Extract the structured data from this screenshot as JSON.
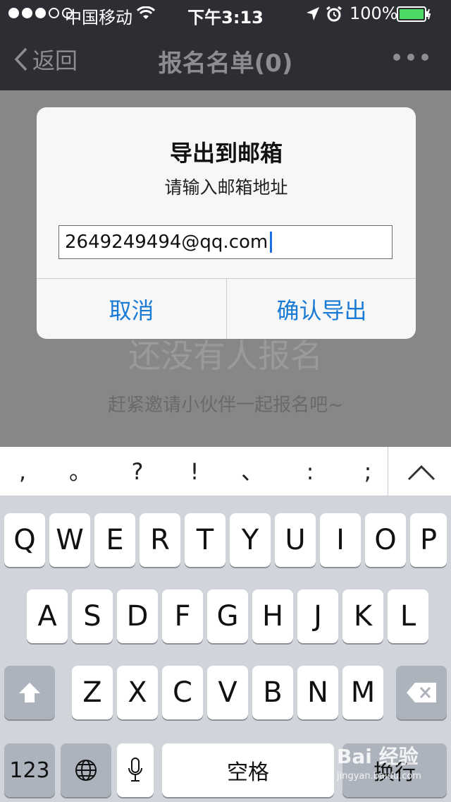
{
  "status_bar": {
    "carrier": "中国移动",
    "time": "下午3:13",
    "battery": "100%",
    "signal_dots_full": 3,
    "signal_dots_total": 5,
    "battery_level": 1.0,
    "battery_color": "#4cd964"
  },
  "nav_bar": {
    "back_label": "返回",
    "title": "报名名单(0)"
  },
  "content": {
    "empty_title": "还没有人报名",
    "empty_subtitle": "赶紧邀请小伙伴一起报名吧~"
  },
  "dialog": {
    "title": "导出到邮箱",
    "message": "请输入邮箱地址",
    "email_value": "2649249494@qq.com",
    "cancel_label": "取消",
    "confirm_label": "确认导出",
    "button_color": "#1a7bd6"
  },
  "candidate_bar": {
    "items": [
      ",",
      "。",
      "?",
      "!",
      "、",
      ":",
      ";"
    ]
  },
  "keyboard": {
    "row1": [
      "Q",
      "W",
      "E",
      "R",
      "T",
      "Y",
      "U",
      "I",
      "O",
      "P"
    ],
    "row2": [
      "A",
      "S",
      "D",
      "F",
      "G",
      "H",
      "J",
      "K",
      "L"
    ],
    "row3": [
      "Z",
      "X",
      "C",
      "V",
      "B",
      "N",
      "M"
    ],
    "numbers_label": "123",
    "space_label": "空格",
    "return_label": "换行"
  },
  "watermark": {
    "brand": "Bai 经验",
    "url": "jingyan.baidu.com"
  }
}
